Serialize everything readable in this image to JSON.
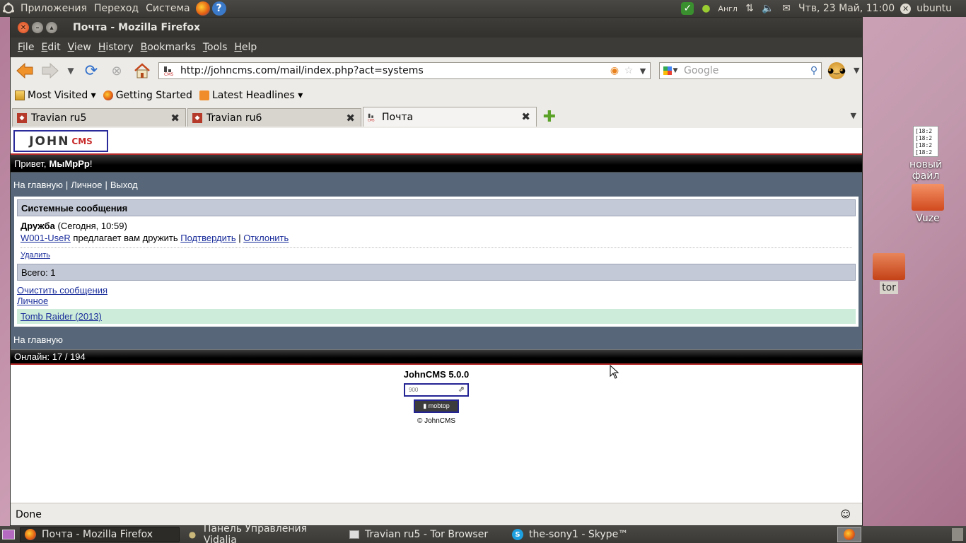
{
  "top_panel": {
    "menus": [
      "Приложения",
      "Переход",
      "Система"
    ],
    "lang": "Англ",
    "datetime": "Чтв, 23 Май, 11:00",
    "user": "ubuntu"
  },
  "window": {
    "title": "Почта - Mozilla Firefox"
  },
  "menubar": [
    "File",
    "Edit",
    "View",
    "History",
    "Bookmarks",
    "Tools",
    "Help"
  ],
  "navbar": {
    "url": "http://johncms.com/mail/index.php?act=systems",
    "search_placeholder": "Google"
  },
  "bookmarks": [
    "Most Visited ▾",
    "Getting Started",
    "Latest Headlines ▾"
  ],
  "tabs": [
    {
      "label": "Travian ru5"
    },
    {
      "label": "Travian ru6"
    },
    {
      "label": "Почта"
    }
  ],
  "page": {
    "logo_main": "JOHN",
    "logo_sub": "CMS",
    "greeting": "Привет,",
    "username": "МыМрРр",
    "greeting_end": "!",
    "nav": [
      "На главную",
      "Личное",
      "Выход"
    ],
    "section_title": "Системные сообщения",
    "message": {
      "type": "Дружба",
      "time": "(Сегодня, 10:59)",
      "sender": "W001-UseR",
      "text": "предлагает вам дружить",
      "confirm": "Подтвердить",
      "separator": "|",
      "decline": "Отклонить",
      "delete": "Удалить"
    },
    "total": "Всего: 1",
    "clear_link": "Очистить сообщения",
    "personal_link": "Личное",
    "ad_link": "Tomb Raider (2013)",
    "home_bottom": "На главную",
    "online": "Онлайн: 17 / 194",
    "version": "JohnCMS 5.0.0",
    "counter_text": "900",
    "mobtop": "mobtop",
    "copyright": "© JohnCMS"
  },
  "status": "Done",
  "desktop_icons": [
    {
      "label": "новый файл",
      "preview": [
        "[18:2",
        "[18:2",
        "[18:2",
        "[18:2"
      ]
    },
    {
      "label": "Vuze"
    },
    {
      "label": "tor"
    }
  ],
  "taskbar": [
    {
      "label": "Почта - Mozilla Firefox"
    },
    {
      "label": "Панель Управления Vidalia"
    },
    {
      "label": "Travian ru5 - Tor Browser"
    },
    {
      "label": "the-sony1 - Skype™"
    }
  ]
}
